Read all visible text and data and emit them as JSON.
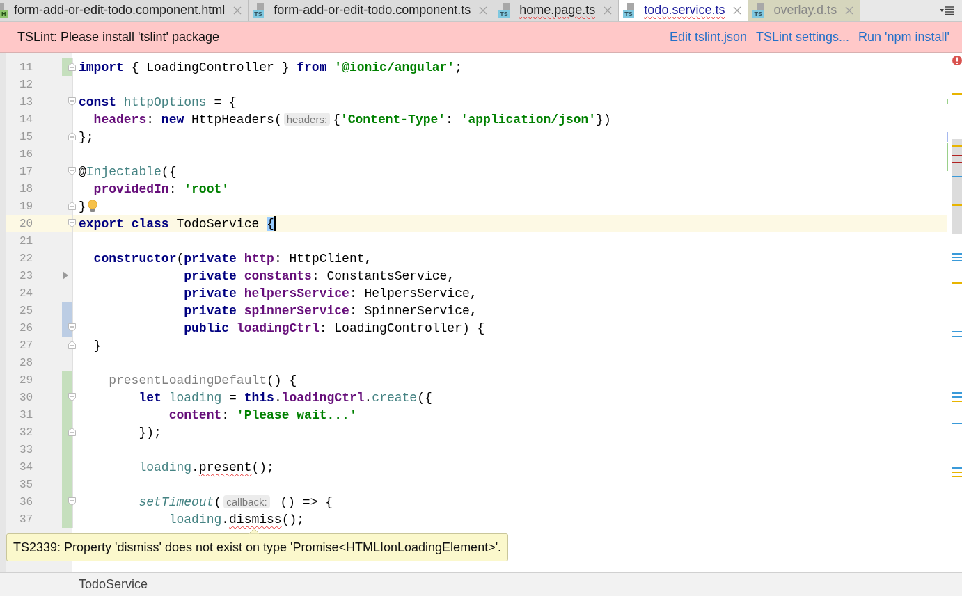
{
  "tabs": [
    {
      "label": "form-add-or-edit-todo.component.html",
      "icon": {
        "label": "H",
        "kind": "html"
      },
      "selected": false,
      "error": false,
      "library": false
    },
    {
      "label": "form-add-or-edit-todo.component.ts",
      "icon": {
        "label": "TS",
        "kind": "ts"
      },
      "selected": false,
      "error": false,
      "library": false
    },
    {
      "label": "home.page.ts",
      "icon": {
        "label": "TS",
        "kind": "ts"
      },
      "selected": false,
      "error": true,
      "library": false
    },
    {
      "label": "todo.service.ts",
      "icon": {
        "label": "TS",
        "kind": "ts"
      },
      "selected": true,
      "error": true,
      "library": false
    },
    {
      "label": "overlay.d.ts",
      "icon": {
        "label": "TS",
        "kind": "ts"
      },
      "selected": false,
      "error": false,
      "library": true
    }
  ],
  "banner": {
    "message": "TSLint: Please install 'tslint' package",
    "actions": [
      "Edit tslint.json",
      "TSLint settings...",
      "Run 'npm install'"
    ]
  },
  "lines": [
    {
      "number": "11",
      "added": true,
      "fold_end": true,
      "tokens": [
        {
          "t": "import",
          "kind": "keyword"
        },
        {
          "t": " { LoadingController } ",
          "kind": "plain"
        },
        {
          "t": "from",
          "kind": "keyword"
        },
        {
          "t": " '@ionic/angular'",
          "kind": "string"
        },
        {
          "t": ";",
          "kind": "plain"
        }
      ]
    },
    {
      "number": "12"
    },
    {
      "number": "13",
      "fold_start": true,
      "tokens": [
        {
          "t": "const",
          "kind": "keyword"
        },
        {
          "t": " httpOptions",
          "kind": "field"
        },
        {
          "t": " = {",
          "kind": "plain"
        }
      ]
    },
    {
      "number": "14",
      "tokens": [
        {
          "t": "  headers",
          "kind": "property"
        },
        {
          "t": ": ",
          "kind": "plain"
        },
        {
          "t": "new",
          "kind": "keyword"
        },
        {
          "t": " HttpHeaders(",
          "kind": "plain"
        },
        {
          "t": "headers:",
          "kind": "hint"
        },
        {
          "t": "{",
          "kind": "plain"
        },
        {
          "t": "'Content-Type'",
          "kind": "string"
        },
        {
          "t": ": ",
          "kind": "plain"
        },
        {
          "t": "'application/json'",
          "kind": "string"
        },
        {
          "t": "})",
          "kind": "plain"
        }
      ]
    },
    {
      "number": "15",
      "fold_end": true,
      "tokens": [
        {
          "t": "};",
          "kind": "plain"
        }
      ]
    },
    {
      "number": "16"
    },
    {
      "number": "17",
      "fold_start": true,
      "tokens": [
        {
          "t": "@",
          "kind": "plain"
        },
        {
          "t": "Injectable",
          "kind": "field"
        },
        {
          "t": "({",
          "kind": "plain"
        }
      ]
    },
    {
      "number": "18",
      "tokens": [
        {
          "t": "  providedIn",
          "kind": "property"
        },
        {
          "t": ": ",
          "kind": "plain"
        },
        {
          "t": "'root'",
          "kind": "string"
        }
      ]
    },
    {
      "number": "19",
      "fold_end": true,
      "bulb": true,
      "tokens": [
        {
          "t": "}",
          "kind": "plain"
        }
      ]
    },
    {
      "number": "20",
      "fold_start": true,
      "current": true,
      "tokens": [
        {
          "t": "export",
          "kind": "keyword"
        },
        {
          "t": " class",
          "kind": "keyword"
        },
        {
          "t": " TodoService ",
          "kind": "plain"
        },
        {
          "t": "{",
          "kind": "match"
        }
      ]
    },
    {
      "number": "21"
    },
    {
      "number": "22",
      "tokens": [
        {
          "t": "  constructor",
          "kind": "keyword"
        },
        {
          "t": "(",
          "kind": "plain"
        },
        {
          "t": "private",
          "kind": "keyword"
        },
        {
          "t": " http",
          "kind": "property"
        },
        {
          "t": ": HttpClient,",
          "kind": "plain"
        }
      ]
    },
    {
      "number": "23",
      "pointer": true,
      "tokens": [
        {
          "t": "              private",
          "kind": "keyword"
        },
        {
          "t": " constants",
          "kind": "property"
        },
        {
          "t": ": ConstantsService,",
          "kind": "plain"
        }
      ]
    },
    {
      "number": "24",
      "tokens": [
        {
          "t": "              private",
          "kind": "keyword"
        },
        {
          "t": " helpersService",
          "kind": "property"
        },
        {
          "t": ": HelpersService,",
          "kind": "plain"
        }
      ]
    },
    {
      "number": "25",
      "modified": true,
      "tokens": [
        {
          "t": "              private",
          "kind": "keyword"
        },
        {
          "t": " spinnerService",
          "kind": "property"
        },
        {
          "t": ": SpinnerService,",
          "kind": "plain"
        }
      ]
    },
    {
      "number": "26",
      "modified": true,
      "fold_start": true,
      "tokens": [
        {
          "t": "              public",
          "kind": "keyword"
        },
        {
          "t": " loadingCtrl",
          "kind": "property"
        },
        {
          "t": ": LoadingController) {",
          "kind": "plain"
        }
      ]
    },
    {
      "number": "27",
      "fold_end": true,
      "tokens": [
        {
          "t": "  }",
          "kind": "plain"
        }
      ]
    },
    {
      "number": "28"
    },
    {
      "number": "29",
      "added": true,
      "tokens": [
        {
          "t": "    presentLoadingDefault",
          "kind": "unused"
        },
        {
          "t": "() {",
          "kind": "plain"
        }
      ]
    },
    {
      "number": "30",
      "added": true,
      "fold_start": true,
      "tokens": [
        {
          "t": "        let",
          "kind": "keyword"
        },
        {
          "t": " loading",
          "kind": "field"
        },
        {
          "t": " = ",
          "kind": "plain"
        },
        {
          "t": "this",
          "kind": "keyword"
        },
        {
          "t": ".",
          "kind": "plain"
        },
        {
          "t": "loadingCtrl",
          "kind": "property"
        },
        {
          "t": ".",
          "kind": "plain"
        },
        {
          "t": "create",
          "kind": "field"
        },
        {
          "t": "({",
          "kind": "plain"
        }
      ]
    },
    {
      "number": "31",
      "added": true,
      "tokens": [
        {
          "t": "            content",
          "kind": "property"
        },
        {
          "t": ": ",
          "kind": "plain"
        },
        {
          "t": "'Please wait...'",
          "kind": "string"
        }
      ]
    },
    {
      "number": "32",
      "added": true,
      "fold_end": true,
      "tokens": [
        {
          "t": "        });",
          "kind": "plain"
        }
      ]
    },
    {
      "number": "33",
      "added": true
    },
    {
      "number": "34",
      "added": true,
      "tokens": [
        {
          "t": "        loading",
          "kind": "field"
        },
        {
          "t": ".",
          "kind": "plain"
        },
        {
          "t": "present",
          "kind": "error"
        },
        {
          "t": "();",
          "kind": "plain"
        }
      ]
    },
    {
      "number": "35",
      "added": true
    },
    {
      "number": "36",
      "added": true,
      "fold_start": true,
      "tokens": [
        {
          "t": "        setTimeout",
          "kind": "italic"
        },
        {
          "t": "(",
          "kind": "plain"
        },
        {
          "t": "callback:",
          "kind": "hint"
        },
        {
          "t": " () => {",
          "kind": "plain"
        }
      ]
    },
    {
      "number": "37",
      "added": true,
      "tokens": [
        {
          "t": "            loading",
          "kind": "field"
        },
        {
          "t": ".",
          "kind": "plain"
        },
        {
          "t": "dismiss",
          "kind": "error"
        },
        {
          "t": "();",
          "kind": "plain"
        }
      ]
    }
  ],
  "tooltip": "TS2339: Property 'dismiss' does not exist on type 'Promise<HTMLIonLoadingElement>'.",
  "breadcrumb": "TodoService"
}
